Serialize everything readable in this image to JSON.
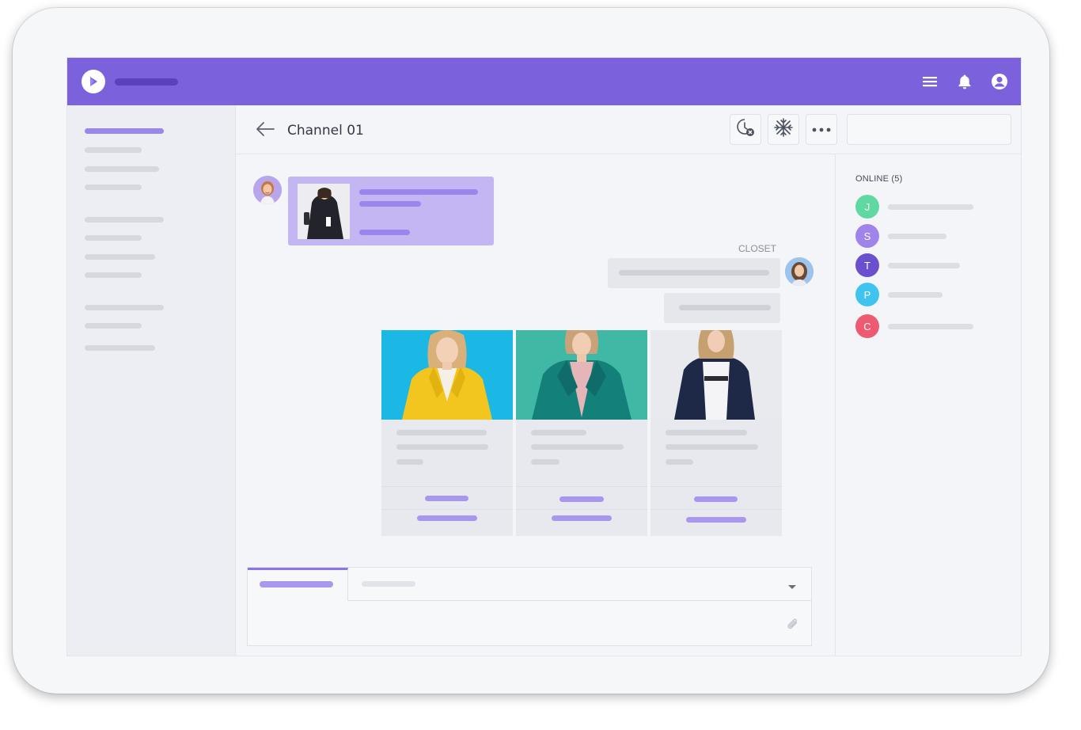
{
  "header": {
    "channel_title": "Channel 01"
  },
  "chat": {
    "sender_label": "CLOSET"
  },
  "online": {
    "title": "ONLINE (5)",
    "users": [
      {
        "initial": "J",
        "color": "#5fd9a1"
      },
      {
        "initial": "S",
        "color": "#9f84ea"
      },
      {
        "initial": "T",
        "color": "#6a4fcf"
      },
      {
        "initial": "P",
        "color": "#3fc3ef"
      },
      {
        "initial": "C",
        "color": "#ef5a73"
      }
    ]
  },
  "colors": {
    "brand": "#7b61dc",
    "accent_light": "#c3b6f2"
  },
  "icons": {
    "logo": "play-logo-icon",
    "menu": "hamburger-menu-icon",
    "notifications": "bell-icon",
    "account": "user-circle-icon",
    "back": "back-arrow-icon",
    "timer": "timer-cancel-icon",
    "freeze": "snowflake-icon",
    "more": "more-dots-icon",
    "attach": "paperclip-icon",
    "dropdown": "chevron-down-icon"
  }
}
